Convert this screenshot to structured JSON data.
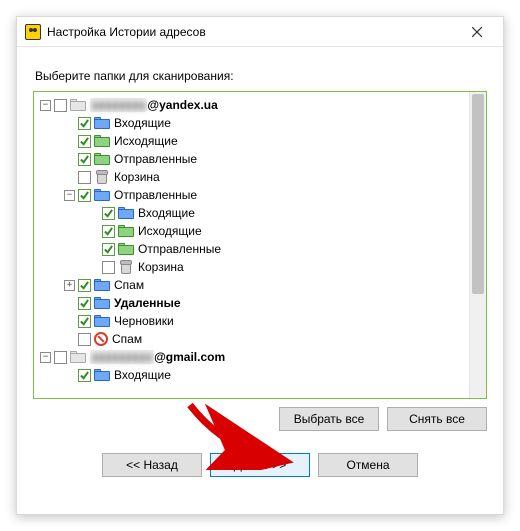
{
  "window": {
    "title": "Настройка Истории адресов"
  },
  "prompt": "Выберите папки для сканирования:",
  "accounts": [
    {
      "label_obscured": "xxxxxxxx",
      "label_domain": "@yandex.ua",
      "checked": false,
      "expanded": true,
      "folders": [
        {
          "label": "Входящие",
          "checked": true,
          "icon": "blue",
          "expanded": null
        },
        {
          "label": "Исходящие",
          "checked": true,
          "icon": "green",
          "expanded": null
        },
        {
          "label": "Отправленные",
          "checked": true,
          "icon": "green",
          "expanded": null
        },
        {
          "label": "Корзина",
          "checked": false,
          "icon": "trash",
          "expanded": null
        },
        {
          "label": "Отправленные",
          "checked": true,
          "icon": "blue",
          "expanded": true,
          "children": [
            {
              "label": "Входящие",
              "checked": true,
              "icon": "blue"
            },
            {
              "label": "Исходящие",
              "checked": true,
              "icon": "green"
            },
            {
              "label": "Отправленные",
              "checked": true,
              "icon": "green"
            },
            {
              "label": "Корзина",
              "checked": false,
              "icon": "trash"
            }
          ]
        },
        {
          "label": "Спам",
          "checked": true,
          "icon": "blue",
          "expanded": false
        },
        {
          "label": "Удаленные",
          "checked": true,
          "icon": "blue",
          "expanded": null,
          "bold": true
        },
        {
          "label": "Черновики",
          "checked": true,
          "icon": "blue",
          "expanded": null
        },
        {
          "label": "Спам",
          "checked": false,
          "icon": "spam",
          "expanded": null
        }
      ]
    },
    {
      "label_obscured": "xxxxxxxxx",
      "label_domain": "@gmail.com",
      "checked": false,
      "expanded": true,
      "folders": [
        {
          "label": "Входящие",
          "checked": true,
          "icon": "blue",
          "expanded": null
        }
      ]
    }
  ],
  "buttons": {
    "select_all": "Выбрать все",
    "deselect_all": "Снять все",
    "back": "<< Назад",
    "next": "Далее >>",
    "cancel": "Отмена"
  }
}
